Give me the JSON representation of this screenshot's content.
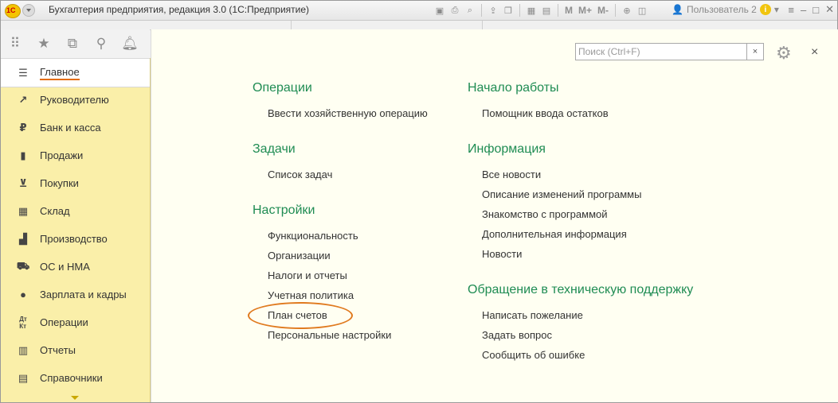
{
  "window": {
    "title": "Бухгалтерия предприятия, редакция 3.0  (1С:Предприятие)",
    "logo": "1С",
    "user": "Пользователь 2",
    "toolbar_m_labels": [
      "M",
      "M+",
      "M-"
    ],
    "info_label": "i"
  },
  "left_tools": [
    "apps-grid-icon",
    "star-icon",
    "history-icon",
    "search-icon",
    "bell-icon"
  ],
  "sidebar": {
    "items": [
      {
        "label": "Главное",
        "icon": "menu-icon",
        "active": true
      },
      {
        "label": "Руководителю",
        "icon": "trend-icon"
      },
      {
        "label": "Банк и касса",
        "icon": "ruble-icon"
      },
      {
        "label": "Продажи",
        "icon": "bag-icon"
      },
      {
        "label": "Покупки",
        "icon": "cart-icon"
      },
      {
        "label": "Склад",
        "icon": "warehouse-icon"
      },
      {
        "label": "Производство",
        "icon": "factory-icon"
      },
      {
        "label": "ОС и НМА",
        "icon": "truck-icon"
      },
      {
        "label": "Зарплата и кадры",
        "icon": "person-icon"
      },
      {
        "label": "Операции",
        "icon": "dt-kt-icon"
      },
      {
        "label": "Отчеты",
        "icon": "bar-chart-icon"
      },
      {
        "label": "Справочники",
        "icon": "book-icon"
      }
    ]
  },
  "search": {
    "placeholder": "Поиск (Ctrl+F)",
    "clear_label": "×"
  },
  "close_label": "×",
  "columns": {
    "left": [
      {
        "title": "Операции",
        "links": [
          "Ввести хозяйственную операцию"
        ]
      },
      {
        "title": "Задачи",
        "links": [
          "Список задач"
        ]
      },
      {
        "title": "Настройки",
        "links": [
          "Функциональность",
          "Организации",
          "Налоги и отчеты",
          "Учетная политика",
          "План счетов",
          "Персональные настройки"
        ]
      }
    ],
    "right": [
      {
        "title": "Начало работы",
        "links": [
          "Помощник ввода остатков"
        ]
      },
      {
        "title": "Информация",
        "links": [
          "Все новости",
          "Описание изменений программы",
          "Знакомство с программой",
          "Дополнительная информация",
          "Новости"
        ]
      },
      {
        "title": "Обращение в техническую поддержку",
        "links": [
          "Написать пожелание",
          "Задать вопрос",
          "Сообщить об ошибке"
        ]
      }
    ]
  },
  "colors": {
    "accent_green": "#1f8c53",
    "highlight_orange": "#e07a1f",
    "sidebar_bg": "#faefa9",
    "content_bg": "#fffff2"
  }
}
